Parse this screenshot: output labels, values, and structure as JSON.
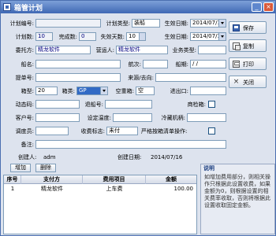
{
  "window": {
    "title": "箱管计划",
    "minimize_glyph": "_",
    "close_glyph": "×"
  },
  "form": {
    "plan_no_label": "计划编号:",
    "plan_type_label": "计划类型:",
    "plan_type_value": "装船",
    "effective_date1_label": "生效日期:",
    "effective_date1_value": "2014/07/16",
    "plan_count_label": "计划数:",
    "plan_count_value": "10",
    "completed_label": "完成数:",
    "completed_value": "0",
    "invalid_days_label": "失效天数:",
    "invalid_days_value": "10",
    "effective_date2_label": "生效日期:",
    "effective_date2_value": "2014/07/16",
    "consignor_label": "委托方:",
    "consignor_value": "精龙软件",
    "sales_rep_label": "营运人:",
    "sales_rep_value": "精龙软件",
    "business_type_label": "业务类型:",
    "ship_name_label": "船名:",
    "voyage_label": "航次:",
    "berth_period_label": "船期:",
    "berth_period_value": "/ /",
    "bl_no_label": "提单号:",
    "origin_dest_label": "来源/去向:",
    "box_type_label": "箱型:",
    "box_type_value": "20",
    "box_class_label": "箱类:",
    "box_class_value": "GP",
    "empty_heavy_label": "空重箱:",
    "empty_heavy_value": "空",
    "import_export_label": "进出口:",
    "power_code_label": "动态码:",
    "return_no_label": "退船号:",
    "dangerous_label": "商检箱:",
    "customer_no_label": "客户号:",
    "set_temp_label": "设定温度:",
    "cold_machine_label": "冷藏机柄:",
    "dispatcher_label": "调度员:",
    "fee_mark_label": "收费标志:",
    "fee_mark_value": "未付",
    "strict_label": "严格按箱清单操作:",
    "remark_label": "备注:",
    "creator_label": "创建人:",
    "creator_value": "adm",
    "create_date_label": "创建日期:",
    "create_date_value": "2014/07/16"
  },
  "side_buttons": {
    "save": "保存",
    "copy": "复制",
    "print": "打印",
    "close": "关闭",
    "close_glyph": "×"
  },
  "fees": {
    "add_label": "增加",
    "delete_label": "删除",
    "columns": [
      "序号",
      "支付方",
      "费用项目",
      "金额"
    ],
    "rows": [
      {
        "seq": "1",
        "payer": "精龙软件",
        "item": "上车费",
        "amount": "100.00"
      }
    ]
  },
  "note": {
    "title": "说明",
    "body": "如增加费用部分，则相关操作只根据此设置收费，如果金额为0，则根据设置的相关费率收取，否则将根据此设置收取固定金额。"
  }
}
